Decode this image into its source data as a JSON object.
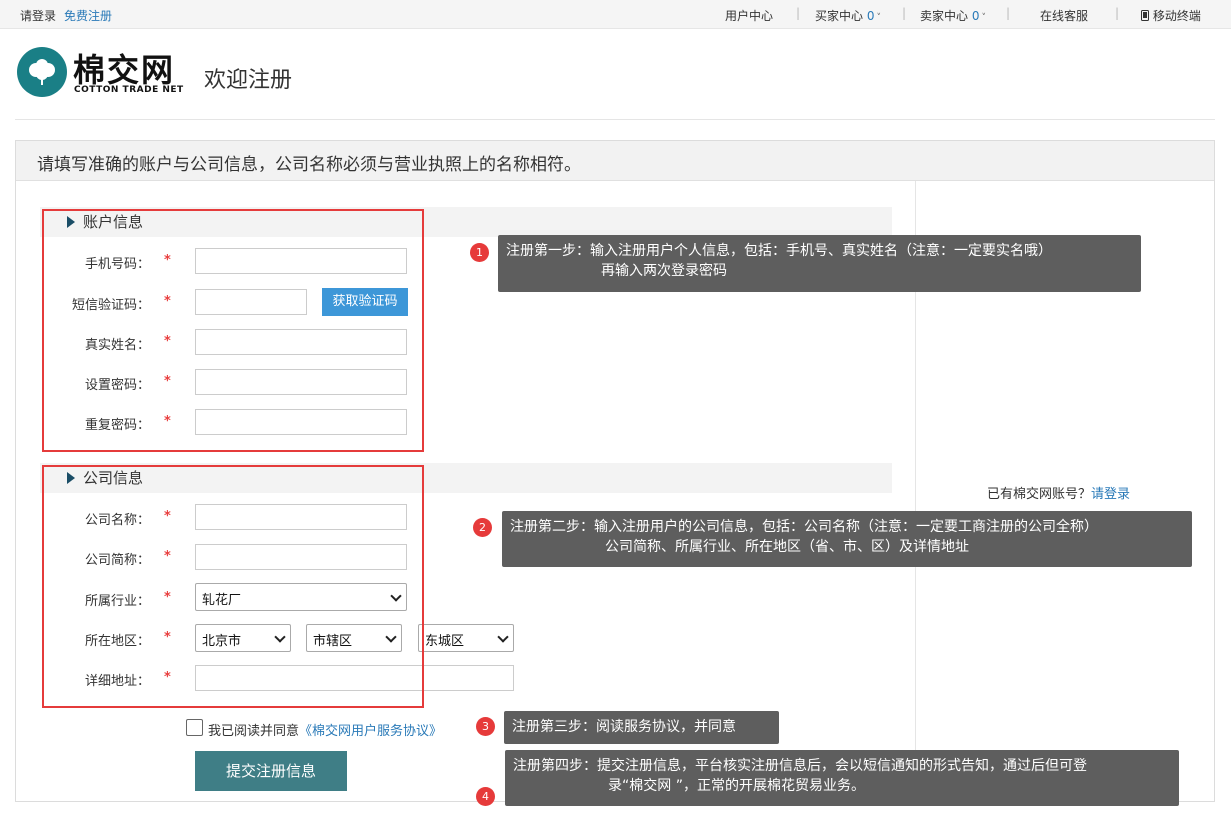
{
  "topbar": {
    "login": "请登录",
    "register": "免费注册",
    "user_center": "用户中心",
    "buyer_center": "买家中心",
    "buyer_count": "0",
    "seller_center": "卖家中心",
    "seller_count": "0",
    "online_service": "在线客服",
    "mobile": "移动终端"
  },
  "header": {
    "logo_cn": "棉交网",
    "logo_en": "COTTON TRADE NET",
    "welcome": "欢迎注册"
  },
  "notice": "请填写准确的账户与公司信息，公司名称必须与营业执照上的名称相符。",
  "account": {
    "title": "账户信息",
    "phone_label": "手机号码：",
    "sms_label": "短信验证码：",
    "sms_button": "获取验证码",
    "name_label": "真实姓名：",
    "pwd_label": "设置密码：",
    "pwd2_label": "重复密码："
  },
  "company": {
    "title": "公司信息",
    "name_label": "公司名称：",
    "short_label": "公司简称：",
    "industry_label": "所属行业：",
    "industry_value": "轧花厂",
    "region_label": "所在地区：",
    "province": "北京市",
    "city": "市辖区",
    "district": "东城区",
    "address_label": "详细地址："
  },
  "required_mark": "*",
  "agreement": {
    "text": "我已阅读并同意",
    "link": "《棉交网用户服务协议》"
  },
  "submit": "提交注册信息",
  "has_account": {
    "text": "已有棉交网账号？",
    "link": "请登录"
  },
  "tips": [
    {
      "num": "1",
      "line1": "注册第一步：输入注册用户个人信息，包括：手机号、真实姓名（注意：一定要实名哦）",
      "line2": "再输入两次登录密码"
    },
    {
      "num": "2",
      "line1": "注册第二步：输入注册用户的公司信息，包括：公司名称（注意：一定要工商注册的公司全称）",
      "line2": "公司简称、所属行业、所在地区（省、市、区）及详情地址"
    },
    {
      "num": "3",
      "line1": "注册第三步：阅读服务协议，并同意",
      "line2": ""
    },
    {
      "num": "4",
      "line1": "注册第四步：提交注册信息，平台核实注册信息后，会以短信通知的形式告知，通过后但可登",
      "line2": "录“棉交网 ”，正常的开展棉花贸易业务。"
    }
  ],
  "colors": {
    "brand": "#1a7f86",
    "link": "#2a7ab8",
    "required": "#e83e3e",
    "highlight": "#e53b3b",
    "submit_bg": "#3f7e86",
    "code_btn": "#3d97d8"
  }
}
